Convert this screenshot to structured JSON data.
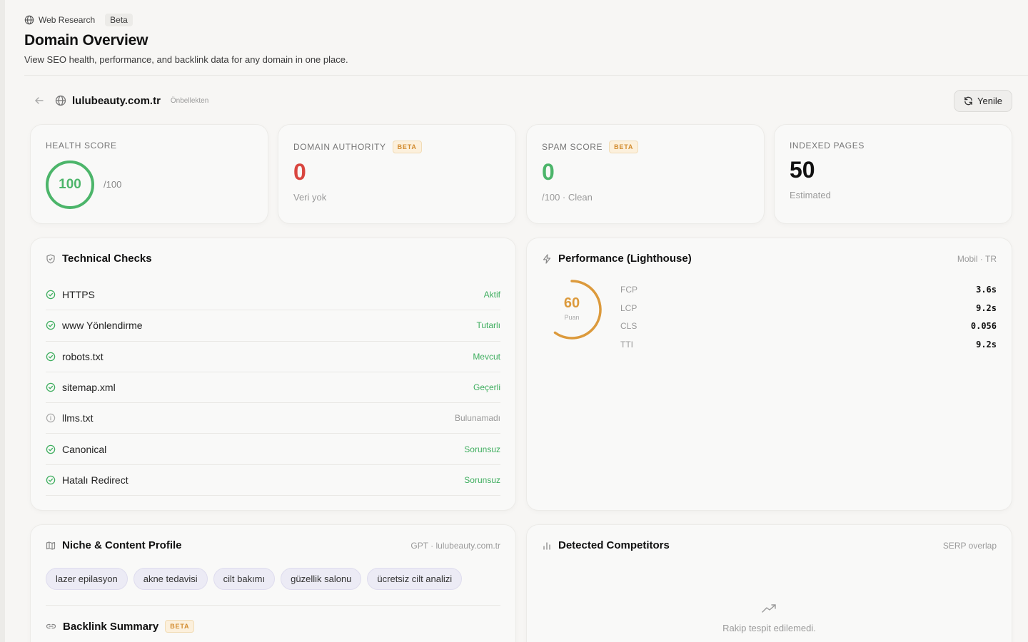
{
  "breadcrumb": {
    "section": "Web Research",
    "badge": "Beta"
  },
  "page": {
    "title": "Domain Overview",
    "subtitle": "View SEO health, performance, and backlink data for any domain in one place."
  },
  "domain_bar": {
    "domain": "lulubeauty.com.tr",
    "cache_label": "Önbellekten",
    "refresh_label": "Yenile"
  },
  "stats": {
    "health": {
      "label": "HEALTH SCORE",
      "value": "100",
      "suffix": "/100",
      "color": "#4cb56a"
    },
    "authority": {
      "label": "DOMAIN AUTHORITY",
      "badge": "BETA",
      "value": "0",
      "sub": "Veri yok",
      "color": "#d9463f"
    },
    "spam": {
      "label": "SPAM SCORE",
      "badge": "BETA",
      "value": "0",
      "sub": "/100 · Clean",
      "color": "#4cb56a"
    },
    "indexed": {
      "label": "INDEXED PAGES",
      "value": "50",
      "sub": "Estimated"
    }
  },
  "technical": {
    "title": "Technical Checks",
    "rows": [
      {
        "label": "HTTPS",
        "value": "Aktif",
        "status": "ok"
      },
      {
        "label": "www Yönlendirme",
        "value": "Tutarlı",
        "status": "ok"
      },
      {
        "label": "robots.txt",
        "value": "Mevcut",
        "status": "ok"
      },
      {
        "label": "sitemap.xml",
        "value": "Geçerli",
        "status": "ok"
      },
      {
        "label": "llms.txt",
        "value": "Bulunamadı",
        "status": "info"
      },
      {
        "label": "Canonical",
        "value": "Sorunsuz",
        "status": "ok"
      },
      {
        "label": "Hatalı Redirect",
        "value": "Sorunsuz",
        "status": "ok"
      }
    ]
  },
  "performance": {
    "title": "Performance (Lighthouse)",
    "meta": "Mobil · TR",
    "score": "60",
    "score_fraction": 0.6,
    "score_label": "Puan",
    "score_color": "#dc9a3c",
    "metrics": [
      {
        "name": "FCP",
        "value": "3.6s"
      },
      {
        "name": "LCP",
        "value": "9.2s"
      },
      {
        "name": "CLS",
        "value": "0.056"
      },
      {
        "name": "TTI",
        "value": "9.2s"
      }
    ]
  },
  "niche": {
    "title": "Niche & Content Profile",
    "meta": "GPT · lulubeauty.com.tr",
    "tags": [
      "lazer epilasyon",
      "akne tedavisi",
      "cilt bakımı",
      "güzellik salonu",
      "ücretsiz cilt analizi"
    ]
  },
  "backlink": {
    "title": "Backlink Summary",
    "badge": "BETA"
  },
  "competitors": {
    "title": "Detected Competitors",
    "meta": "SERP overlap",
    "empty": "Rakip tespit edilemedi."
  }
}
